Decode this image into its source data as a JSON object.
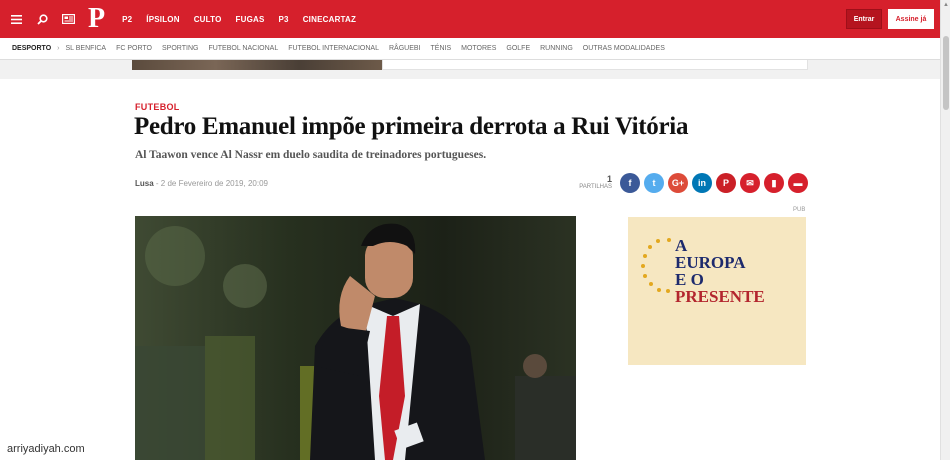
{
  "header": {
    "logo": "P",
    "nav": [
      "P2",
      "ÍPSILON",
      "CULTO",
      "FUGAS",
      "P3",
      "CINECARTAZ"
    ],
    "login_label": "Entrar",
    "subscribe_label": "Assine já"
  },
  "subnav": {
    "section": "DESPORTO",
    "separator": "›",
    "items": [
      "SL BENFICA",
      "FC PORTO",
      "SPORTING",
      "FUTEBOL NACIONAL",
      "FUTEBOL INTERNACIONAL",
      "RÂGUEBI",
      "TÉNIS",
      "MOTORES",
      "GOLFE",
      "RUNNING",
      "OUTRAS MODALIDADES"
    ]
  },
  "article": {
    "section": "FUTEBOL",
    "headline": "Pedro Emanuel impõe primeira derrota a Rui Vitória",
    "lead": "Al Taawon vence Al Nassr em duelo saudita de treinadores portugueses.",
    "author": "Lusa",
    "date": " - 2 de Fevereiro de 2019, 20:09",
    "shares_count": "1",
    "shares_label": "PARTILHAS"
  },
  "social": [
    {
      "name": "facebook",
      "glyph": "f",
      "color": "#3b5998"
    },
    {
      "name": "twitter",
      "glyph": "t",
      "color": "#55acee"
    },
    {
      "name": "google-plus",
      "glyph": "G+",
      "color": "#dd4b39"
    },
    {
      "name": "linkedin",
      "glyph": "in",
      "color": "#0077b5"
    },
    {
      "name": "pinterest",
      "glyph": "P",
      "color": "#cb2027"
    },
    {
      "name": "email",
      "glyph": "✉",
      "color": "#d6202c"
    },
    {
      "name": "bookmark",
      "glyph": "▮",
      "color": "#d6202c"
    },
    {
      "name": "comments",
      "glyph": "▬",
      "color": "#d6202c"
    }
  ],
  "ad": {
    "pub_label": "PUB",
    "line1": "A",
    "line2": "EUROPA",
    "line3": "E O",
    "line4": "PRESENTE"
  },
  "watermark": "arriyadiyah.com",
  "colors": {
    "brand_red": "#d6202c"
  }
}
